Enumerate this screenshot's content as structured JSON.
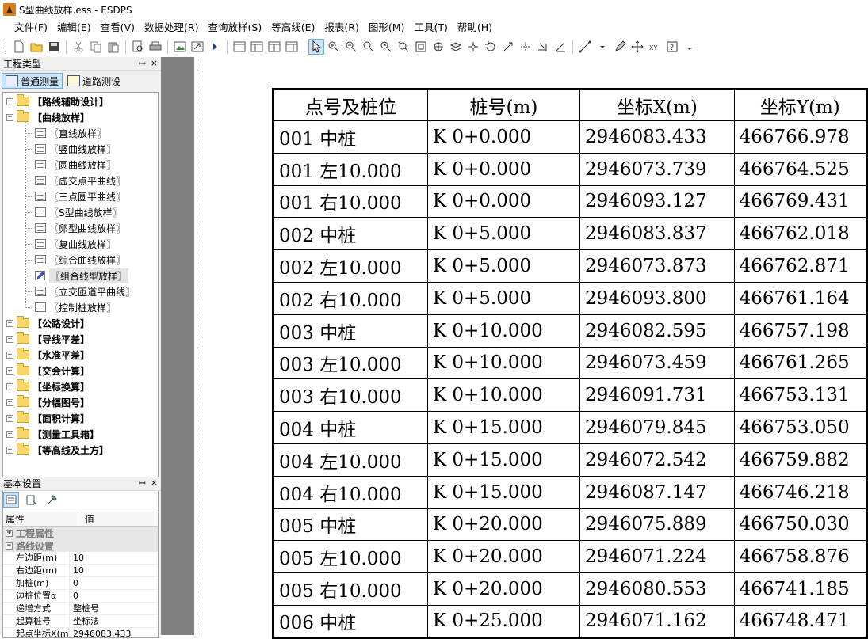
{
  "window": {
    "title": "S型曲线放样.ess - ESDPS"
  },
  "menu": [
    {
      "label": "文件(",
      "key": "F",
      "tail": ")"
    },
    {
      "label": "编辑(",
      "key": "E",
      "tail": ")"
    },
    {
      "label": "查看(",
      "key": "V",
      "tail": ")"
    },
    {
      "label": "数据处理(",
      "key": "R",
      "tail": ")"
    },
    {
      "label": "查询放样(",
      "key": "S",
      "tail": ")"
    },
    {
      "label": "等高线(",
      "key": "E",
      "tail": ")"
    },
    {
      "label": "报表(",
      "key": "R",
      "tail": ")"
    },
    {
      "label": "图形(",
      "key": "M",
      "tail": ")"
    },
    {
      "label": "工具(",
      "key": "T",
      "tail": ")"
    },
    {
      "label": "帮助(",
      "key": "H",
      "tail": ")"
    }
  ],
  "left_panel": {
    "title": "工程类型",
    "pin": "ꟷ",
    "close": "×",
    "tabs": [
      {
        "label": "普通测量",
        "active": true
      },
      {
        "label": "道路测设",
        "active": false
      }
    ],
    "tree": [
      {
        "label": "【路线辅助设计】",
        "type": "folder",
        "expander": "+",
        "level": 0
      },
      {
        "label": "【曲线放样】",
        "type": "folder",
        "expander": "−",
        "level": 0
      },
      {
        "label": "〖直线放样〗",
        "type": "doc",
        "level": 1
      },
      {
        "label": "〖竖曲线放样〗",
        "type": "doc",
        "level": 1
      },
      {
        "label": "〖圆曲线放样〗",
        "type": "doc",
        "level": 1
      },
      {
        "label": "〖虚交点平曲线〗",
        "type": "doc",
        "level": 1
      },
      {
        "label": "〖三点圆平曲线〗",
        "type": "doc",
        "level": 1
      },
      {
        "label": "〖S型曲线放样〗",
        "type": "doc",
        "level": 1
      },
      {
        "label": "〖卵型曲线放样〗",
        "type": "doc",
        "level": 1
      },
      {
        "label": "〖复曲线放样〗",
        "type": "doc",
        "level": 1
      },
      {
        "label": "〖综合曲线放样〗",
        "type": "doc",
        "level": 1
      },
      {
        "label": "〖组合线型放样〗",
        "type": "edit",
        "level": 1,
        "selected": true
      },
      {
        "label": "〖立交匝道平曲线〗",
        "type": "doc",
        "level": 1
      },
      {
        "label": "〖控制桩放样〗",
        "type": "doc",
        "level": 1
      },
      {
        "label": "【公路设计】",
        "type": "folder",
        "expander": "+",
        "level": 0
      },
      {
        "label": "【导线平差】",
        "type": "folder",
        "expander": "+",
        "level": 0
      },
      {
        "label": "【水准平差】",
        "type": "folder",
        "expander": "+",
        "level": 0
      },
      {
        "label": "【交会计算】",
        "type": "folder",
        "expander": "+",
        "level": 0
      },
      {
        "label": "【坐标换算】",
        "type": "folder",
        "expander": "+",
        "level": 0
      },
      {
        "label": "【分幅图号】",
        "type": "folder",
        "expander": "+",
        "level": 0
      },
      {
        "label": "【面积计算】",
        "type": "folder",
        "expander": "+",
        "level": 0
      },
      {
        "label": "【测量工具箱】",
        "type": "folder",
        "expander": "+",
        "level": 0
      },
      {
        "label": "【等高线及土方】",
        "type": "folder",
        "expander": "+",
        "level": 0
      }
    ]
  },
  "props_panel": {
    "title": "基本设置",
    "pin": "ꟷ",
    "close": "×",
    "col_name": "属性",
    "col_value": "值",
    "categories": [
      {
        "label": "工程属性",
        "expander": "+"
      },
      {
        "label": "路线设置",
        "expander": "−"
      }
    ],
    "rows": [
      {
        "k": "左边距(m)",
        "v": "10"
      },
      {
        "k": "右边距(m)",
        "v": "10"
      },
      {
        "k": "加桩(m)",
        "v": "0"
      },
      {
        "k": "边桩位置α",
        "v": "0"
      },
      {
        "k": "递增方式",
        "v": "整桩号"
      },
      {
        "k": "起算桩号",
        "v": "坐标法"
      },
      {
        "k": "起点坐标X(m)",
        "v": "2946083.433"
      }
    ]
  },
  "report": {
    "headers": [
      "点号及桩位",
      "桩号(m)",
      "坐标X(m)",
      "坐标Y(m)"
    ],
    "rows": [
      [
        "001 中桩",
        "K 0+0.000",
        "2946083.433",
        "466766.978"
      ],
      [
        "001 左10.000",
        "K 0+0.000",
        "2946073.739",
        "466764.525"
      ],
      [
        "001 右10.000",
        "K 0+0.000",
        "2946093.127",
        "466769.431"
      ],
      [
        "002 中桩",
        "K 0+5.000",
        "2946083.837",
        "466762.018"
      ],
      [
        "002 左10.000",
        "K 0+5.000",
        "2946073.873",
        "466762.871"
      ],
      [
        "002 右10.000",
        "K 0+5.000",
        "2946093.800",
        "466761.164"
      ],
      [
        "003 中桩",
        "K 0+10.000",
        "2946082.595",
        "466757.198"
      ],
      [
        "003 左10.000",
        "K 0+10.000",
        "2946073.459",
        "466761.265"
      ],
      [
        "003 右10.000",
        "K 0+10.000",
        "2946091.731",
        "466753.131"
      ],
      [
        "004 中桩",
        "K 0+15.000",
        "2946079.845",
        "466753.050"
      ],
      [
        "004 左10.000",
        "K 0+15.000",
        "2946072.542",
        "466759.882"
      ],
      [
        "004 右10.000",
        "K 0+15.000",
        "2946087.147",
        "466746.218"
      ],
      [
        "005 中桩",
        "K 0+20.000",
        "2946075.889",
        "466750.030"
      ],
      [
        "005 左10.000",
        "K 0+20.000",
        "2946071.224",
        "466758.876"
      ],
      [
        "005 右10.000",
        "K 0+20.000",
        "2946080.553",
        "466741.185"
      ],
      [
        "006 中桩",
        "K 0+25.000",
        "2946071.162",
        "466748.471"
      ]
    ]
  }
}
